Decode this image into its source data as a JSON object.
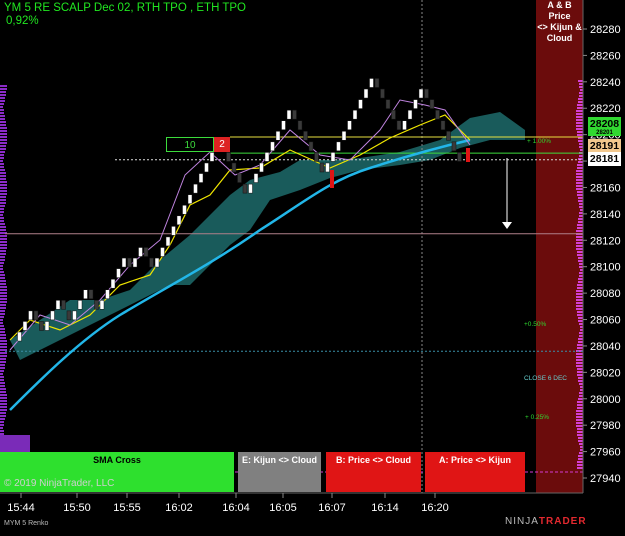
{
  "instrument": {
    "title": "YM 5 RE SCALP Dec 02, RTH TPO , ETH TPO",
    "change": "0,92%"
  },
  "copyright": "© 2019 NinjaTrader, LLC",
  "footer_instrument": "MYM 5 Renko",
  "brand": {
    "part1": "NINJA",
    "part2": "TRADER"
  },
  "side_header": {
    "line1": "A & B Price",
    "line2": "<> Kijun &",
    "line3": "Cloud"
  },
  "signals": {
    "sma_cross": "SMA  Cross",
    "kijun_cloud": "E: Kijun <> Cloud",
    "price_cloud": "B: Price <> Cloud",
    "price_kijun": "A: Price <> Kijun"
  },
  "trade_box": {
    "qty": "10",
    "stop": "2"
  },
  "price_tags": {
    "current_high": "28208",
    "entry": "28191",
    "last": "28181",
    "hidden": "28201"
  },
  "annotations": {
    "p100": "+ 1.00%",
    "p050": "+0.50%",
    "p025": "+ 0.25%",
    "close": "CLOSE 6 DEC"
  },
  "colors": {
    "up": "#ffffff",
    "down": "#3a3a3a",
    "sma": "#22b6e8",
    "kijun": "#f0e600",
    "tenkan": "#c084e0",
    "cloud": "#1d6b6b",
    "accent_red": "#8b0a0a"
  },
  "chart_data": {
    "type": "renko-bars",
    "y_axis": {
      "ticks": [
        28280,
        28260,
        28240,
        28220,
        28200,
        28180,
        28160,
        28140,
        28120,
        28100,
        28080,
        28060,
        28040,
        28020,
        28000,
        27980,
        27960,
        27940
      ],
      "range": [
        27935,
        28293
      ]
    },
    "x_axis": {
      "ticks": [
        "15:44",
        "15:50",
        "15:55",
        "16:02",
        "16:04",
        "16:05",
        "16:07",
        "16:14",
        "16:20"
      ]
    },
    "levels": {
      "entry": 28181,
      "target": 28125,
      "close_6_dec": 28036,
      "pct_100": 28186
    },
    "bricks": [
      28038,
      28046,
      28054,
      28062,
      28054,
      28046,
      28054,
      28062,
      28070,
      28062,
      28054,
      28062,
      28070,
      28078,
      28070,
      28062,
      28070,
      28078,
      28086,
      28094,
      28102,
      28094,
      28102,
      28110,
      28102,
      28094,
      28102,
      28110,
      28118,
      28126,
      28134,
      28142,
      28150,
      28158,
      28166,
      28174,
      28182,
      28190,
      28182,
      28174,
      28166,
      28158,
      28150,
      28158,
      28166,
      28174,
      28182,
      28190,
      28198,
      28206,
      28214,
      28206,
      28198,
      28190,
      28182,
      28174,
      28166,
      28174,
      28182,
      28190,
      28198,
      28206,
      28214,
      28222,
      28230,
      28238,
      28230,
      28222,
      28214,
      28206,
      28198,
      28206,
      28214,
      28222,
      28230,
      28222,
      28214,
      28206,
      28198,
      28190,
      28182,
      28174
    ]
  }
}
